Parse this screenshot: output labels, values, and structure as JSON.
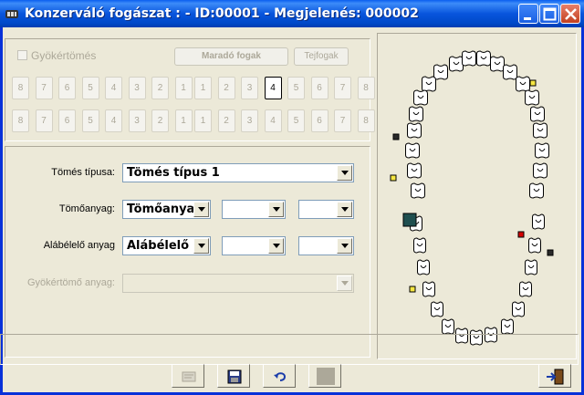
{
  "window": {
    "title": "Konzerváló fogászat :  - ID:00001 - Megjelenés: 000002",
    "app_icon": "dental-app-icon",
    "controls": [
      "minimize-icon",
      "maximize-icon",
      "close-icon"
    ]
  },
  "top_panel": {
    "root_filling_checkbox": {
      "label": "Gyökértömés",
      "checked": false,
      "enabled": false
    },
    "remaining_teeth_button": "Maradó fogak",
    "milk_teeth_button": "Tejfogak",
    "upper_row": {
      "left": [
        "8",
        "7",
        "6",
        "5",
        "4",
        "3",
        "2",
        "1"
      ],
      "right": [
        "1",
        "2",
        "3",
        "4",
        "5",
        "6",
        "7",
        "8"
      ]
    },
    "lower_row": {
      "left": [
        "8",
        "7",
        "6",
        "5",
        "4",
        "3",
        "2",
        "1"
      ],
      "right": [
        "1",
        "2",
        "3",
        "4",
        "5",
        "6",
        "7",
        "8"
      ]
    },
    "selected_tooth": {
      "row": "upper",
      "side": "right",
      "number": "4"
    }
  },
  "form": {
    "filling_type": {
      "label": "Tömés típusa:",
      "value": "Tömés típus 1"
    },
    "filling_material": {
      "label": "Tömőanyag:",
      "values": [
        "Tömőanyag",
        "",
        ""
      ]
    },
    "base_material": {
      "label": "Alábélelő anyag",
      "values": [
        "Alábélelő a",
        "",
        ""
      ]
    },
    "root_material": {
      "label": "Gyökértömő anyag:",
      "value": "",
      "enabled": false
    }
  },
  "tooth_chart": {
    "icon": "dental-arch-chart",
    "marker_colors": {
      "yellow": "#f5e642",
      "red": "#d40000",
      "dark": "#2a2a2a",
      "selected_fill": "#1f4f4f"
    }
  },
  "bottom_toolbar": {
    "buttons": [
      "edit-icon",
      "save-icon",
      "undo-icon",
      "blank-icon",
      "exit-icon"
    ]
  }
}
